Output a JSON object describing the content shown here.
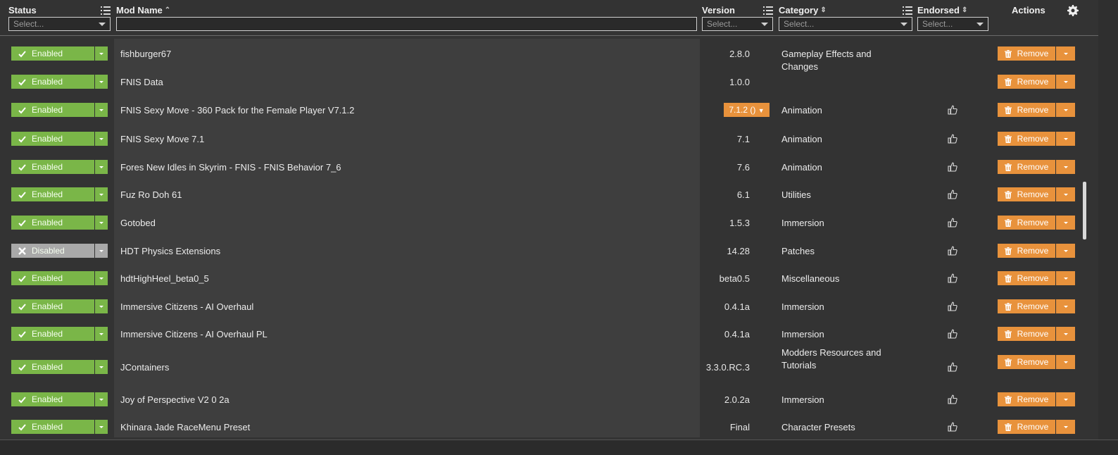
{
  "header": {
    "status_label": "Status",
    "modname_label": "Mod Name",
    "version_label": "Version",
    "category_label": "Category",
    "endorsed_label": "Endorsed",
    "actions_label": "Actions",
    "status_filter": "Select...",
    "version_filter": "Select...",
    "category_filter": "Select...",
    "endorsed_filter": "Select...",
    "modname_filter": ""
  },
  "rows": [
    {
      "status": "Enabled",
      "name": "fishburger67",
      "version": "2.8.0",
      "category": "Gameplay Effects and Changes",
      "endorse": false,
      "action": "Remove"
    },
    {
      "status": "Enabled",
      "name": "FNIS Data",
      "version": "1.0.0",
      "category": "",
      "endorse": false,
      "action": "Remove"
    },
    {
      "status": "Enabled",
      "name": "FNIS Sexy Move - 360 Pack for the Female Player V7.1.2",
      "version": "7.1.2 ()",
      "category": "Animation",
      "endorse": true,
      "action": "Remove"
    },
    {
      "status": "Enabled",
      "name": "FNIS Sexy Move 7.1",
      "version": "7.1",
      "category": "Animation",
      "endorse": true,
      "action": "Remove"
    },
    {
      "status": "Enabled",
      "name": "Fores New Idles in Skyrim - FNIS - FNIS Behavior 7_6",
      "version": "7.6",
      "category": "Animation",
      "endorse": true,
      "action": "Remove"
    },
    {
      "status": "Enabled",
      "name": "Fuz Ro Doh 61",
      "version": "6.1",
      "category": "Utilities",
      "endorse": true,
      "action": "Remove"
    },
    {
      "status": "Enabled",
      "name": "Gotobed",
      "version": "1.5.3",
      "category": "Immersion",
      "endorse": true,
      "action": "Remove"
    },
    {
      "status": "Disabled",
      "name": "HDT Physics Extensions",
      "version": "14.28",
      "category": "Patches",
      "endorse": true,
      "action": "Remove"
    },
    {
      "status": "Enabled",
      "name": "hdtHighHeel_beta0_5",
      "version": "beta0.5",
      "category": "Miscellaneous",
      "endorse": true,
      "action": "Remove"
    },
    {
      "status": "Enabled",
      "name": "Immersive Citizens - AI Overhaul",
      "version": "0.4.1a",
      "category": "Immersion",
      "endorse": true,
      "action": "Remove"
    },
    {
      "status": "Enabled",
      "name": "Immersive Citizens - AI Overhaul PL",
      "version": "0.4.1a",
      "category": "Immersion",
      "endorse": true,
      "action": "Remove"
    },
    {
      "status": "Enabled",
      "name": "JContainers",
      "version": "3.3.0.RC.3",
      "category": "Modders Resources and Tutorials",
      "endorse": true,
      "action": "Remove"
    },
    {
      "status": "Enabled",
      "name": "Joy of Perspective V2 0 2a",
      "version": "2.0.2a",
      "category": "Immersion",
      "endorse": true,
      "action": "Remove"
    },
    {
      "status": "Enabled",
      "name": "Khinara Jade RaceMenu Preset",
      "version": "Final",
      "category": "Character Presets",
      "endorse": true,
      "action": "Remove"
    }
  ]
}
